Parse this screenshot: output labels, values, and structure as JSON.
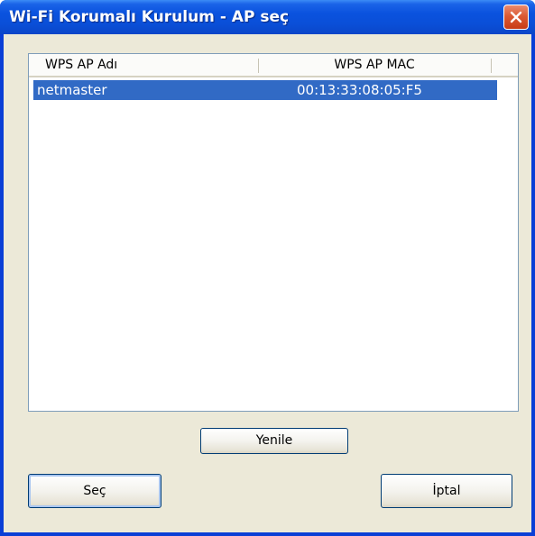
{
  "window": {
    "title": "Wi-Fi Korumalı Kurulum - AP seç"
  },
  "ap_list": {
    "columns": [
      "WPS AP Adı",
      "WPS AP MAC"
    ],
    "rows": [
      {
        "name": "netmaster",
        "mac": "00:13:33:08:05:F5",
        "selected": true
      }
    ]
  },
  "buttons": {
    "refresh": "Yenile",
    "select": "Seç",
    "cancel": "İptal"
  },
  "colors": {
    "titlebar": "#0a52de",
    "selection": "#316ac5",
    "dialog_bg": "#ece9d8",
    "close_button": "#dc5a34"
  }
}
